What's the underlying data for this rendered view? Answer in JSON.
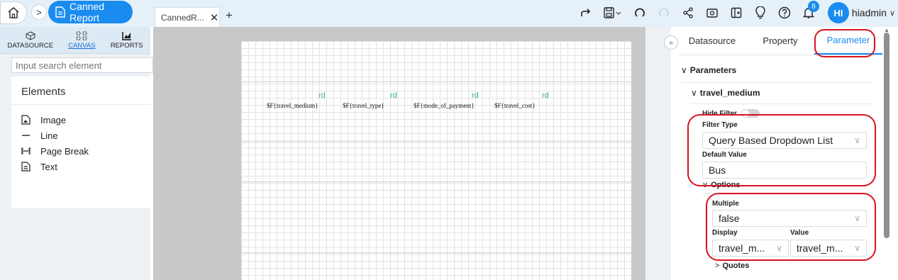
{
  "header": {
    "breadcrumb_title": "Canned Report",
    "doc_tab": "CannedR...",
    "username": "hiadmin",
    "avatar_initials": "HI",
    "notification_count": "8",
    "accent": "#1a8cf0"
  },
  "left": {
    "tabs": [
      {
        "label": "DATASOURCE",
        "icon": "cube-icon"
      },
      {
        "label": "CANVAS",
        "icon": "canvas-icon"
      },
      {
        "label": "REPORTS",
        "icon": "chart-icon"
      }
    ],
    "search_placeholder": "Input search element",
    "elements_title": "Elements",
    "elements": [
      {
        "label": "Image",
        "icon": "image-icon"
      },
      {
        "label": "Line",
        "icon": "line-icon"
      },
      {
        "label": "Page Break",
        "icon": "page-break-icon"
      },
      {
        "label": "Text",
        "icon": "text-icon"
      }
    ]
  },
  "canvas": {
    "fields": [
      "$F{travel_medium}",
      "$F{travel_type}",
      "$F{mode_of_payment}",
      "$F{travel_cost}"
    ],
    "markers": [
      "rd",
      "rd",
      "rd",
      "rd"
    ]
  },
  "right": {
    "tabs": [
      "Datasource",
      "Property",
      "Parameter"
    ],
    "parameters_label": "Parameters",
    "param_name": "travel_medium",
    "hide_filter_label": "Hide Filter",
    "filter_type_label": "Filter Type",
    "filter_type_value": "Query Based Dropdown List",
    "default_value_label": "Default Value",
    "default_value": "Bus",
    "options_label": "Options",
    "multiple_label": "Multiple",
    "multiple_value": "false",
    "display_label": "Display",
    "value_label": "Value",
    "display_value": "travel_m...",
    "value_value": "travel_m...",
    "quotes_label": "Quotes"
  }
}
